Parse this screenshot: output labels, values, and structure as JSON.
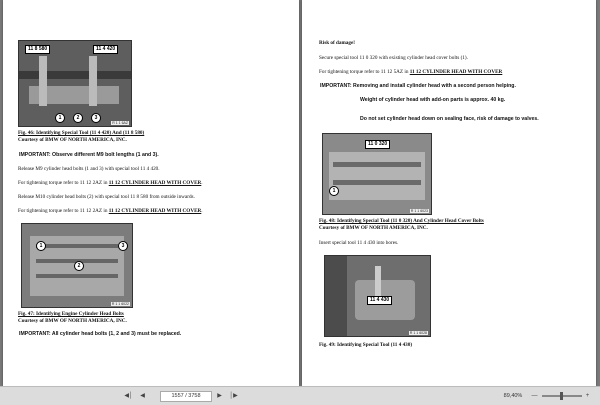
{
  "left_page": {
    "fig46_tag_a": "11 8 580",
    "fig46_tag_b": "11 4 420",
    "fig46_callout_1": "1",
    "fig46_callout_2": "2",
    "fig46_callout_3": "3",
    "fig46_ref": "R 1 1 6AZ",
    "fig46_caption": "Fig. 46: Identifying Special Tool (11 4 420) And (11 8 580)",
    "fig46_courtesy": "Courtesy of BMW OF NORTH AMERICA, INC.",
    "important_1": "IMPORTANT:  Observe different M9 bolt lengths (1 and 3).",
    "release_m9": "Release M9 cylinder head bolts (1 and 3) with special tool 11 4 420.",
    "torque_1_prefix": "For tightening torque refer to 11 12 2AZ in ",
    "torque_1_link": "11 12 CYLINDER HEAD WITH COVER",
    "torque_1_suffix": ".",
    "release_m10": "Release M10 cylinder head bolts (2) with special tool 11 8 580 from outside inwards.",
    "torque_2_prefix": "For tightening torque refer to 11 12 2AZ in ",
    "torque_2_link": "11 12 CYLINDER HEAD WITH COVER",
    "torque_2_suffix": ".",
    "fig47_callout_1": "1",
    "fig47_callout_2": "2",
    "fig47_callout_3": "3",
    "fig47_ref": "R 1 1 6022",
    "fig47_caption": "Fig. 47: Identifying Engine Cylinder Head Bolts",
    "fig47_courtesy": "Courtesy of BMW OF NORTH AMERICA, INC.",
    "important_2": "IMPORTANT:  All cylinder head bolts (1, 2 and 3) must be replaced."
  },
  "right_page": {
    "risk": "Risk of damage!",
    "secure": "Secure special tool 11 0 320 with existing cylinder head cover bolts (1).",
    "torque_prefix": "For tightening torque refer to 11 12 5AZ in ",
    "torque_link": "11 12 CYLINDER HEAD WITH COVER",
    "important": "IMPORTANT:  Removing and install cylinder head with a second person helping.",
    "weight": "Weight of cylinder head with add-on parts is approx. 40 kg.",
    "do_not_set": "Do not set cylinder head down on sealing face, risk of damage to valves.",
    "fig48_tag": "11 0 320",
    "fig48_callout_1": "1",
    "fig48_ref": "R 1 1 6023",
    "fig48_caption": "Fig. 48: Identifying Special Tool (11 0 320) And Cylinder Head Cover Bolts",
    "fig48_courtesy": "Courtesy of BMW OF NORTH AMERICA, INC.",
    "insert": "Insert special tool 11 4 430 into bores.",
    "fig49_tag": "11 4 430",
    "fig49_ref": "R 1 1 6028",
    "fig49_caption": "Fig. 49: Identifying Special Tool (11 4 430)"
  },
  "toolbar": {
    "first_icon": "first-page-icon",
    "prev_icon": "prev-page-icon",
    "next_icon": "next-page-icon",
    "last_icon": "last-page-icon",
    "page_indicator": "1557 / 3758",
    "zoom_value": "89,40%",
    "zoom_out_label": "—",
    "zoom_in_label": "+",
    "fit_icon": "fit-page-icon"
  },
  "colors": {
    "viewer_bg": "#7a7a7a",
    "toolbar_bg": "#dcdcdc",
    "page_bg": "#ffffff"
  }
}
